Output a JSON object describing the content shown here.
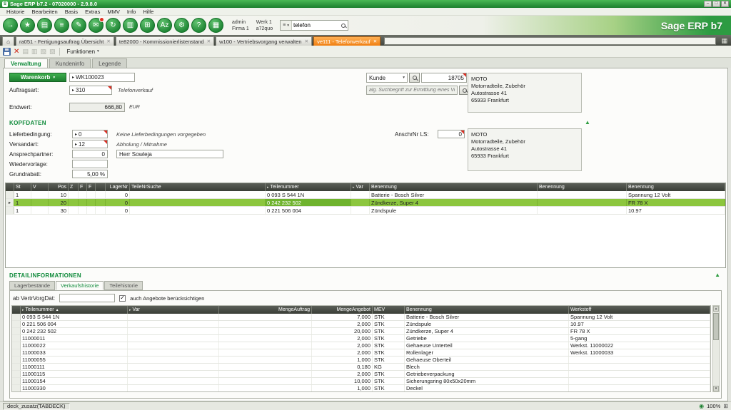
{
  "window": {
    "title": "Sage ERP b7.2 - 07020000 - 2.9.8.0",
    "brand": "Sage ERP b7",
    "app_initial": "S"
  },
  "icons": {
    "close": "✕",
    "minimize": "–",
    "maximize": "□",
    "home": "⌂",
    "caret_down": "▾",
    "arrow_right": "▸",
    "collapse_up": "▲",
    "tri_up": "▴",
    "tri_down": "▾",
    "grid": "▦",
    "check": "✓",
    "list": "≡",
    "zoom_circle": "◉",
    "box": "⊞",
    "doc1": "▤",
    "doc2": "▥",
    "doc3": "▧",
    "doc4": "▨"
  },
  "menu": {
    "items": [
      "Historie",
      "Bearbeiten",
      "Basis",
      "Extras",
      "MMV",
      "Info",
      "Hilfe"
    ]
  },
  "toolbar": {
    "user_line1": "admin",
    "user_line2": "Firma 1",
    "werk_line1": "Werk 1",
    "werk_line2": "a72quo",
    "search_value": "telefon",
    "icons": [
      {
        "name": "logout-icon",
        "glyph": "→"
      },
      {
        "name": "favorites-icon",
        "glyph": "★"
      },
      {
        "name": "documents-icon",
        "glyph": "▤"
      },
      {
        "name": "worklist-icon",
        "glyph": "≡"
      },
      {
        "name": "edit-icon",
        "glyph": "✎"
      },
      {
        "name": "messages-icon",
        "glyph": "✉",
        "badge": true
      },
      {
        "name": "refresh-icon",
        "glyph": "↻"
      },
      {
        "name": "reports-icon",
        "glyph": "▥"
      },
      {
        "name": "calculator-icon",
        "glyph": "⊞"
      },
      {
        "name": "sort-az-icon",
        "glyph": "Az"
      },
      {
        "name": "settings-icon",
        "glyph": "⚙"
      },
      {
        "name": "help-icon",
        "glyph": "?"
      },
      {
        "name": "apps-icon",
        "glyph": "▦"
      }
    ]
  },
  "doc_tabs": {
    "items": [
      {
        "label": "ra051 - Fertigungsauftrag Übersicht",
        "active": false
      },
      {
        "label": "te82000 - Kommissionierlistenstand",
        "active": false
      },
      {
        "label": "w100 - Vertriebsvorgang verwalten",
        "active": false
      },
      {
        "label": "ve111 - Telefonverkauf",
        "active": true
      }
    ]
  },
  "actionbar": {
    "funktionen": "Funktionen"
  },
  "view_tabs": {
    "items": [
      "Verwaltung",
      "Kundeninfo",
      "Legende"
    ],
    "active": 0
  },
  "form": {
    "warenkorb_label": "Warenkorb",
    "warenkorb_value": "WK100023",
    "auftragsart_label": "Auftragsart:",
    "auftragsart_value": "310",
    "auftragsart_note": "Telefonverkauf",
    "endwert_label": "Endwert:",
    "endwert_value": "666,80",
    "endwert_unit": "EUR",
    "kunde_label": "Kunde",
    "kunde_value": "18705",
    "search_placeholder": "alg. Suchbegriff zur Ermittlung eines Vorg",
    "address": [
      "MOTO",
      "Motorradteile, Zubehör",
      "Autostrasse 41",
      "65933 Frankfurt"
    ]
  },
  "kopfdaten": {
    "title": "KOPFDATEN",
    "lieferbedingung_label": "Lieferbedingung:",
    "lieferbedingung_value": "0",
    "lieferbedingung_note": "Keine Lieferbedingungen vorgegeben",
    "versandart_label": "Versandart:",
    "versandart_value": "12",
    "versandart_note": "Abholung / Mitnahme",
    "ansprechpartner_label": "Ansprechpartner:",
    "ansprechpartner_value": "0",
    "ansprechpartner_name": "Herr Sowleja",
    "wiedervorlage_label": "Wiedervorlage:",
    "wiedervorlage_value": "",
    "grundrabatt_label": "Grundrabatt:",
    "grundrabatt_value": "5,00 %",
    "anschr_label": "AnschrNr LS:",
    "anschr_value": "0",
    "address": [
      "MOTO",
      "Motorradteile, Zubehör",
      "Autostrasse 41",
      "65933 Frankfurt"
    ]
  },
  "main_grid": {
    "columns": [
      "St",
      "V",
      "Pos",
      "Z",
      "F",
      "F",
      "",
      "LagerNr",
      "TeileNrSuche",
      "Teilenummer",
      "Var",
      "Benennung",
      "Benennung",
      "Benennung"
    ],
    "rows": [
      [
        "1",
        "",
        "10",
        "",
        "",
        "",
        "",
        "0",
        "",
        "0 093 S 544 1N",
        "",
        "Batterie - Bosch Silver",
        "",
        "Spannung 12 Volt"
      ],
      [
        "1",
        "",
        "20",
        "",
        "",
        "",
        "",
        "0",
        "",
        "0 242 232 502",
        "",
        "Zündkerze, Super 4",
        "",
        "FR 78 X"
      ],
      [
        "1",
        "",
        "30",
        "",
        "",
        "",
        "",
        "0",
        "",
        "0 221 506 004",
        "",
        "Zündspule",
        "",
        "10.97"
      ]
    ],
    "selected_row": 1,
    "highlight": {
      "row": 1,
      "col": 9
    }
  },
  "detail": {
    "title": "DETAILINFORMATIONEN",
    "tabs": {
      "items": [
        "Lagerbestände",
        "Verkaufshistorie",
        "Teilehistorie"
      ],
      "active": 1
    },
    "filter_label": "ab VertrVorgDat:",
    "filter_value": "",
    "checkbox_checked": true,
    "checkbox_label": "auch Angebote berücksichtigen",
    "grid": {
      "columns": [
        "Teilenummer",
        "Var",
        "MengeAuftrag",
        "MengeAngebot",
        "MEV",
        "Benennung",
        "Werkstoff"
      ],
      "rows": [
        [
          "0 093 S 544 1N",
          "",
          "",
          "7,000",
          "STK",
          "Batterie - Bosch Silver",
          "Spannung 12 Volt"
        ],
        [
          "0 221 506 004",
          "",
          "",
          "2,000",
          "STK",
          "Zündspule",
          "10.97"
        ],
        [
          "0 242 232 502",
          "",
          "",
          "20,000",
          "STK",
          "Zündkerze, Super 4",
          "FR 78 X"
        ],
        [
          "11000011",
          "",
          "",
          "2,000",
          "STK",
          "Getriebe",
          "5-gang"
        ],
        [
          "11000022",
          "",
          "",
          "2,000",
          "STK",
          "Gehaeuse Unterteil",
          "Werkst. 11000022"
        ],
        [
          "11000033",
          "",
          "",
          "2,000",
          "STK",
          "Rollenlager",
          "Werkst. 11000033"
        ],
        [
          "11000055",
          "",
          "",
          "1,000",
          "STK",
          "Gehaeuse Oberteil",
          ""
        ],
        [
          "11000111",
          "",
          "",
          "0,180",
          "KG",
          "Blech",
          ""
        ],
        [
          "11000115",
          "",
          "",
          "2,000",
          "STK",
          "Getriebeverpackung",
          ""
        ],
        [
          "11000154",
          "",
          "",
          "10,000",
          "STK",
          "Sicherungsring 80x50x20mm",
          ""
        ],
        [
          "11000330",
          "",
          "",
          "1,000",
          "STK",
          "Deckel",
          ""
        ]
      ]
    }
  },
  "statusbar": {
    "left": "deck_zusatz(TABDECK)",
    "zoom": "100%"
  }
}
